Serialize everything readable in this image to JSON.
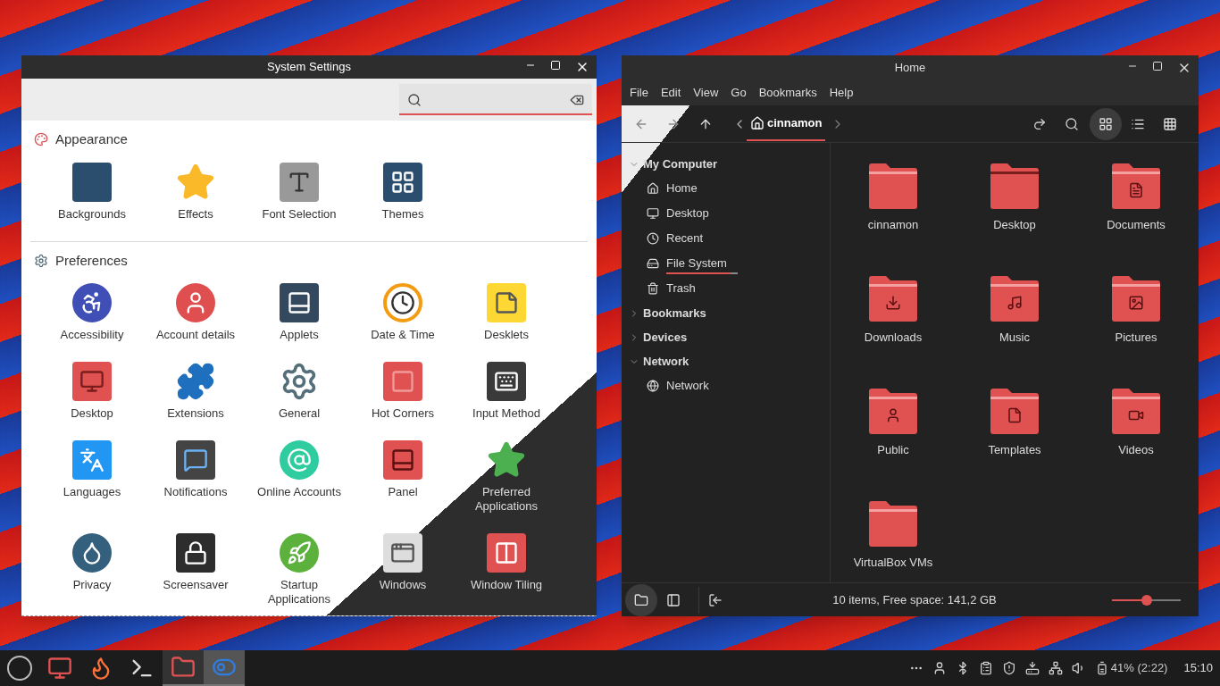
{
  "settings_window": {
    "title": "System Settings",
    "sections": [
      {
        "title": "Appearance",
        "items": [
          {
            "label": "Backgrounds"
          },
          {
            "label": "Effects"
          },
          {
            "label": "Font Selection"
          },
          {
            "label": "Themes"
          }
        ]
      },
      {
        "title": "Preferences",
        "items": [
          {
            "label": "Accessibility"
          },
          {
            "label": "Account details"
          },
          {
            "label": "Applets"
          },
          {
            "label": "Date & Time"
          },
          {
            "label": "Desklets"
          },
          {
            "label": "Desktop"
          },
          {
            "label": "Extensions"
          },
          {
            "label": "General"
          },
          {
            "label": "Hot Corners"
          },
          {
            "label": "Input Method"
          },
          {
            "label": "Languages"
          },
          {
            "label": "Notifications"
          },
          {
            "label": "Online Accounts"
          },
          {
            "label": "Panel"
          },
          {
            "label": "Preferred Applications"
          },
          {
            "label": "Privacy"
          },
          {
            "label": "Screensaver"
          },
          {
            "label": "Startup Applications"
          },
          {
            "label": "Windows"
          },
          {
            "label": "Window Tiling"
          }
        ]
      }
    ]
  },
  "files_window": {
    "title": "Home",
    "menu": [
      "File",
      "Edit",
      "View",
      "Go",
      "Bookmarks",
      "Help"
    ],
    "path": [
      {
        "label": "cinnamon",
        "selected": true
      }
    ],
    "view_modes": [
      {
        "selected": true
      },
      {
        "selected": false
      },
      {
        "selected": false
      }
    ],
    "sidebar": [
      {
        "title": "My Computer",
        "expanded": true,
        "children": [
          {
            "label": "Home"
          },
          {
            "label": "Desktop"
          },
          {
            "label": "Recent"
          },
          {
            "label": "File System",
            "level": 0.9
          },
          {
            "label": "Trash"
          }
        ]
      },
      {
        "title": "Bookmarks",
        "expanded": false
      },
      {
        "title": "Devices",
        "expanded": false
      },
      {
        "title": "Network",
        "expanded": true,
        "children": [
          {
            "label": "Network"
          }
        ]
      }
    ],
    "files": [
      {
        "label": "cinnamon"
      },
      {
        "label": "Desktop"
      },
      {
        "label": "Documents"
      },
      {
        "label": "Downloads"
      },
      {
        "label": "Music"
      },
      {
        "label": "Pictures"
      },
      {
        "label": "Public"
      },
      {
        "label": "Templates"
      },
      {
        "label": "Videos"
      },
      {
        "label": "VirtualBox VMs"
      }
    ],
    "pane_modes": [
      {
        "selected": true
      },
      {
        "selected": false
      }
    ],
    "status": "10 items, Free space: 141,2 GB",
    "zoom": {
      "level": 0.5
    }
  },
  "taskbar": {
    "apps": [
      {
        "running": false,
        "selected": false
      },
      {
        "running": false,
        "selected": false
      },
      {
        "running": false,
        "selected": false
      },
      {
        "running": true,
        "selected": false
      },
      {
        "running": true,
        "selected": true
      }
    ],
    "battery": "41% (2:22)",
    "clock": "15:10"
  }
}
